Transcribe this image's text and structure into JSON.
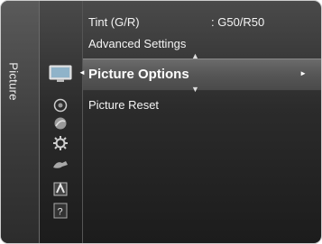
{
  "menu": {
    "category": "Picture"
  },
  "rows": {
    "tint_label": "Tint (G/R)",
    "tint_value": ": G50/R50",
    "advanced": "Advanced Settings",
    "picture_options": "Picture Options",
    "picture_reset": "Picture Reset"
  },
  "icons": [
    "picture-icon",
    "sound-icon",
    "channel-icon",
    "setup-icon",
    "input-icon",
    "application-icon",
    "support-icon"
  ]
}
